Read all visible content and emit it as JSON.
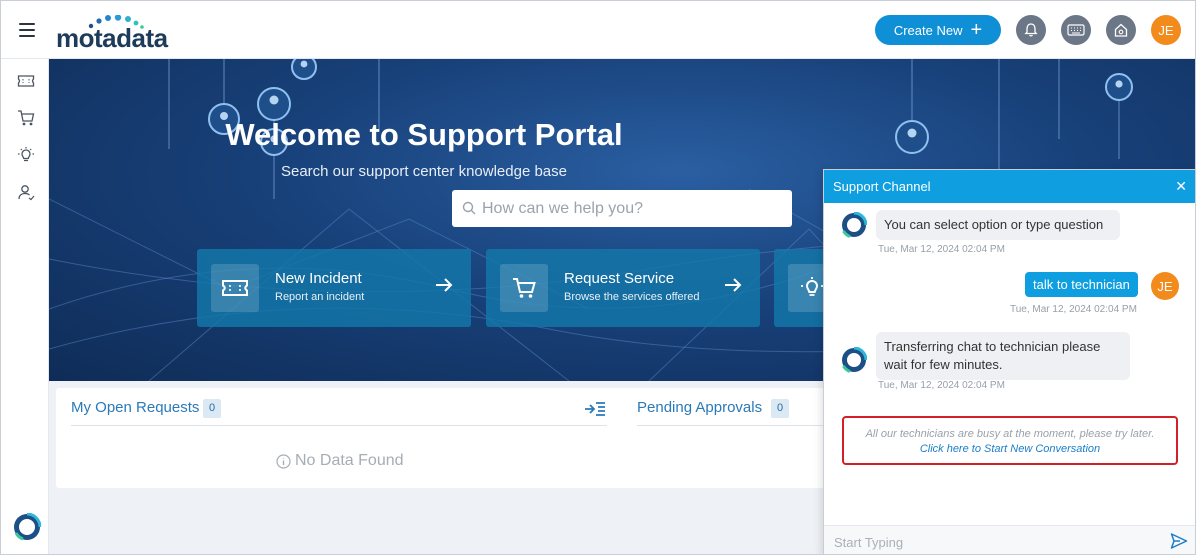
{
  "header": {
    "logo_text": "motadata",
    "create_new_label": "Create New",
    "user_initials": "JE",
    "colors": {
      "accent": "#0f8fd6",
      "avatar": "#f28a1c",
      "icon_bg": "#6b7786"
    }
  },
  "rail": {
    "items": [
      "ticket-icon",
      "cart-icon",
      "bulb-icon",
      "user-icon"
    ]
  },
  "hero": {
    "title": "Welcome to Support Portal",
    "subtitle": "Search our support center knowledge base",
    "search_placeholder": "How can we help you?",
    "tiles": [
      {
        "title": "New Incident",
        "desc": "Report an incident",
        "icon": "ticket-icon"
      },
      {
        "title": "Request Service",
        "desc": "Browse the services offered",
        "icon": "cart-icon"
      },
      {
        "title": "",
        "desc": "",
        "icon": "bulb-icon"
      }
    ]
  },
  "cards": {
    "open_requests": {
      "title": "My Open Requests",
      "count": "0",
      "empty": "No Data Found"
    },
    "pending_approvals": {
      "title": "Pending Approvals",
      "count": "0"
    }
  },
  "chat": {
    "title": "Support Channel",
    "messages": [
      {
        "from": "bot",
        "text": "You can select option or type question",
        "time": "Tue, Mar 12, 2024 02:04 PM"
      },
      {
        "from": "user",
        "text": "talk to technician",
        "time": "Tue, Mar 12, 2024 02:04 PM",
        "initials": "JE"
      },
      {
        "from": "bot",
        "text": "Transferring chat to technician please wait for few minutes.",
        "time": "Tue, Mar 12, 2024 02:04 PM"
      }
    ],
    "busy_notice": "All our technicians are busy at the moment, please try later.",
    "start_new_link": "Click here to Start New Conversation",
    "input_placeholder": "Start Typing"
  }
}
